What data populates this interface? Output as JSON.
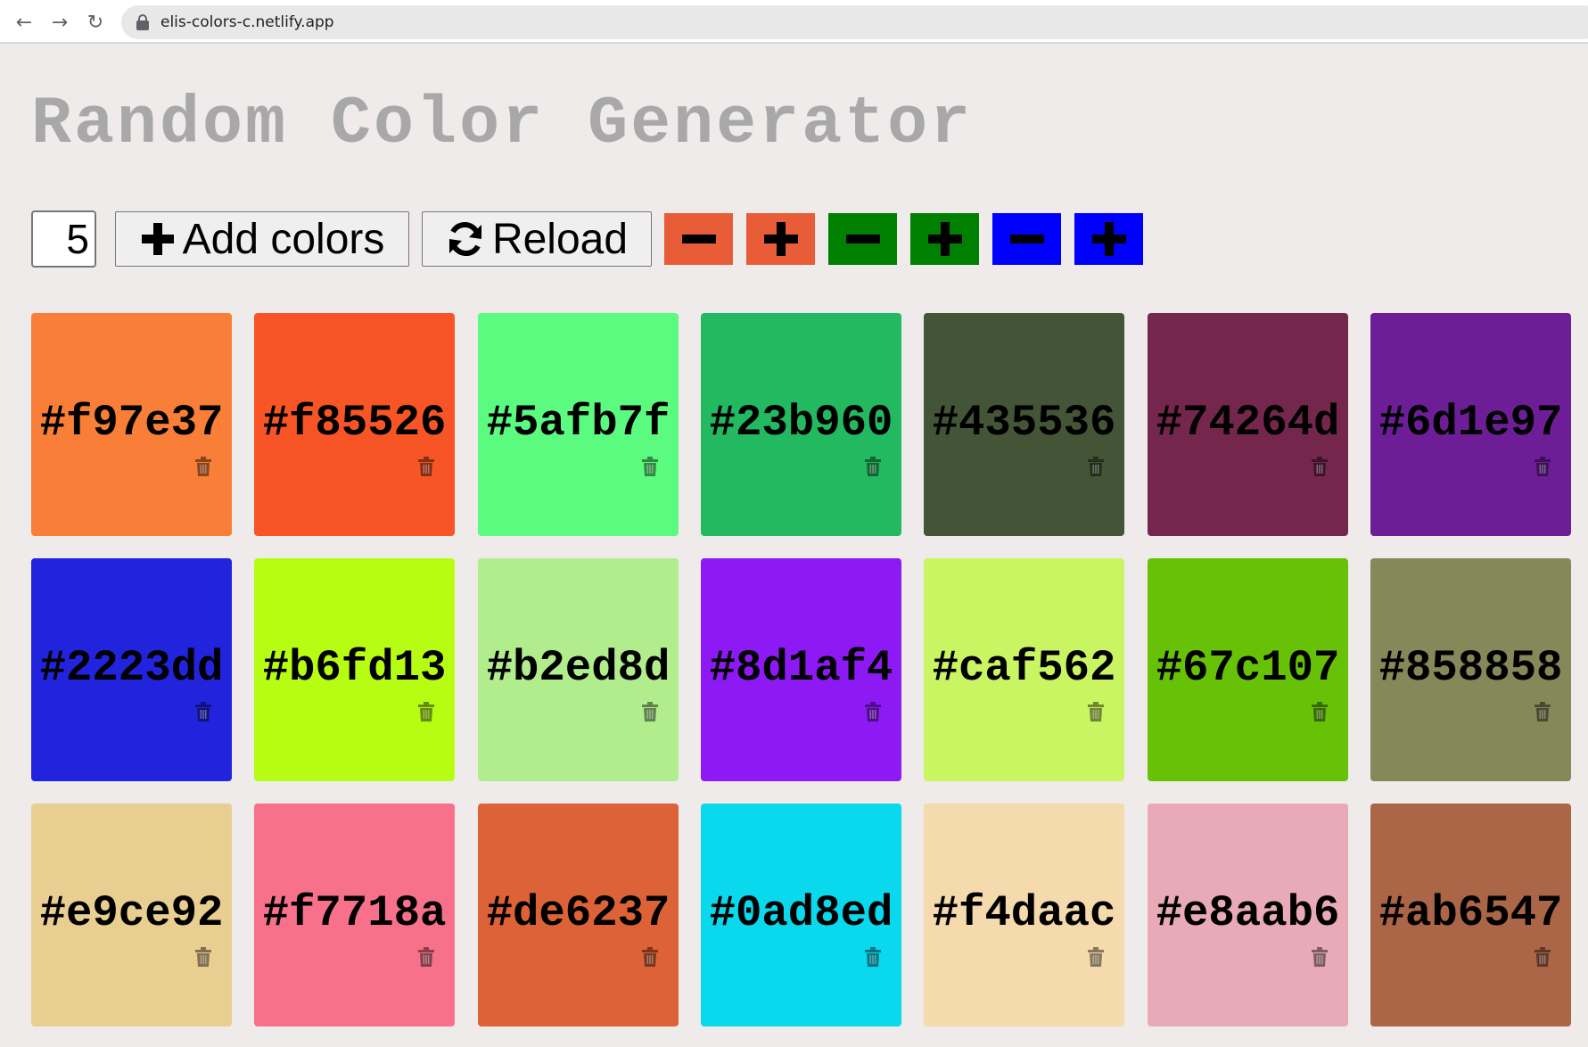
{
  "browser": {
    "url": "elis-colors-c.netlify.app"
  },
  "page": {
    "title": "Random Color Generator"
  },
  "controls": {
    "count_value": "5",
    "add_label": "Add colors",
    "reload_label": "Reload",
    "adjusters": [
      {
        "channel": "red",
        "color": "#e85c37",
        "minus": "minus-icon",
        "plus": "plus-icon"
      },
      {
        "channel": "green",
        "color": "#008000",
        "minus": "minus-icon",
        "plus": "plus-icon"
      },
      {
        "channel": "blue",
        "color": "#0000ff",
        "minus": "minus-icon",
        "plus": "plus-icon"
      }
    ]
  },
  "colors": [
    "#f97e37",
    "#f85526",
    "#5afb7f",
    "#23b960",
    "#435536",
    "#74264d",
    "#6d1e97",
    "#2223dd",
    "#b6fd13",
    "#b2ed8d",
    "#8d1af4",
    "#caf562",
    "#67c107",
    "#858858",
    "#e9ce92",
    "#f7718a",
    "#de6237",
    "#0ad8ed",
    "#f4daac",
    "#e8aab6",
    "#ab6547"
  ]
}
